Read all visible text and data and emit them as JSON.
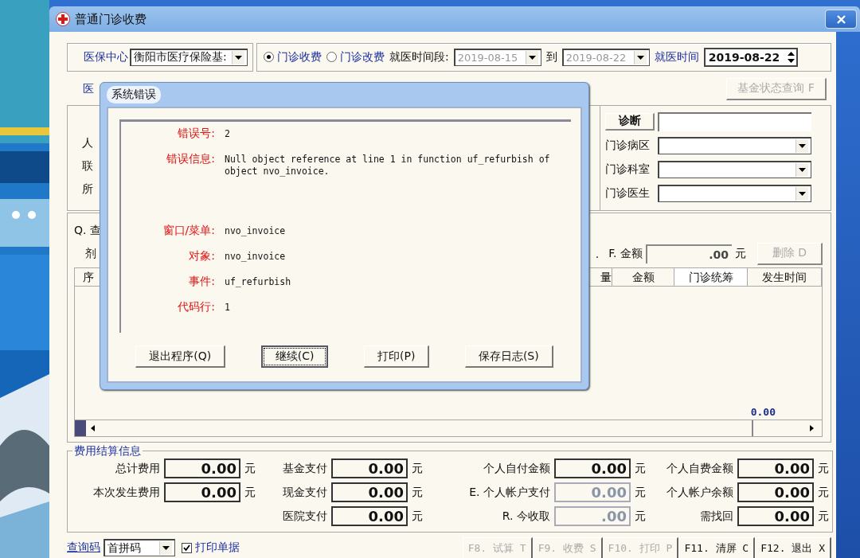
{
  "window": {
    "title": "普通门诊收费"
  },
  "header": {
    "center_label": "医保中心",
    "center_value": "衡阳市医疗保险基:",
    "charge_modes": [
      {
        "label": "门诊收费",
        "selected": true
      },
      {
        "label": "门诊改费",
        "selected": false
      }
    ],
    "period_label": "就医时间段:",
    "period_from": "2019-08-15",
    "period_to_label": "到",
    "period_to": "2019-08-22",
    "visit_time_label": "就医时间",
    "visit_time": "2019-08-22"
  },
  "row2": {
    "label": "医",
    "fund_button": {
      "label": "基金状态查询 F",
      "disabled": true
    }
  },
  "patient": {
    "labels": [
      "人",
      "联",
      "所"
    ],
    "diagnosis_button": "诊断",
    "selects": [
      {
        "label": "门诊病区"
      },
      {
        "label": "门诊科室"
      },
      {
        "label": "门诊医生"
      }
    ]
  },
  "detail": {
    "query_label": "Q. 查",
    "item_label": "剂",
    "dot": ".",
    "amount_label": "F. 金额",
    "amount": ".00",
    "amount_unit": "元",
    "delete_button": {
      "label": "删除 D",
      "disabled": true
    },
    "columns": [
      "序",
      "量",
      "金额",
      "门诊统筹",
      "发生时间"
    ],
    "total": "0.00"
  },
  "fees": {
    "title": "费用结算信息",
    "columns": [
      [
        {
          "label": "总计费用",
          "value": "0.00",
          "unit": "元",
          "disabled": false
        },
        {
          "label": "本次发生费用",
          "value": "0.00",
          "unit": "元",
          "disabled": false
        }
      ],
      [
        {
          "label": "基金支付",
          "value": "0.00",
          "unit": "元",
          "disabled": false
        },
        {
          "label": "现金支付",
          "value": "0.00",
          "unit": "元",
          "disabled": false
        },
        {
          "label": "医院支付",
          "value": "0.00",
          "unit": "元",
          "disabled": false
        }
      ],
      [
        {
          "label": "个人自付金额",
          "value": "0.00",
          "unit": "元",
          "disabled": false
        },
        {
          "label": "E. 个人帐户支付",
          "value": "0.00",
          "unit": "元",
          "disabled": true
        },
        {
          "label": "R. 今收取",
          "value": ".00",
          "unit": "元",
          "disabled": true
        }
      ],
      [
        {
          "label": "个人自费金额",
          "value": "0.00",
          "unit": "元",
          "disabled": false
        },
        {
          "label": "个人帐户余额",
          "value": "0.00",
          "unit": "元",
          "disabled": false
        },
        {
          "label": "需找回",
          "value": "0.00",
          "unit": "元",
          "disabled": false
        }
      ]
    ]
  },
  "bottom": {
    "query_code_label": "查询码",
    "query_code_value": "首拼码",
    "print_receipt": {
      "label": "打印单据",
      "checked": true
    },
    "actions": [
      {
        "label": "F8. 试算 T",
        "disabled": true
      },
      {
        "label": "F9. 收费 S",
        "disabled": true
      },
      {
        "label": "F10. 打印 P",
        "disabled": true
      },
      {
        "label": "F11. 清屏 C",
        "disabled": false
      },
      {
        "label": "F12. 退出 X",
        "disabled": false
      }
    ]
  },
  "dialog": {
    "title": "系统错误",
    "fields": [
      {
        "label": "错误号:",
        "value": "2"
      },
      {
        "label": "错误信息:",
        "value": "Null object reference at line 1 in function uf_refurbish of object nvo_invoice."
      },
      {
        "label": "窗口/菜单:",
        "value": "nvo_invoice"
      },
      {
        "label": "对象:",
        "value": "nvo_invoice"
      },
      {
        "label": "事件:",
        "value": "uf_refurbish"
      },
      {
        "label": "代码行:",
        "value": "1"
      }
    ],
    "buttons": [
      {
        "label": "退出程序(Q)",
        "focused": false
      },
      {
        "label": "继续(C)",
        "focused": true
      },
      {
        "label": "打印(P)",
        "focused": false
      },
      {
        "label": "保存日志(S)",
        "focused": false
      }
    ]
  }
}
